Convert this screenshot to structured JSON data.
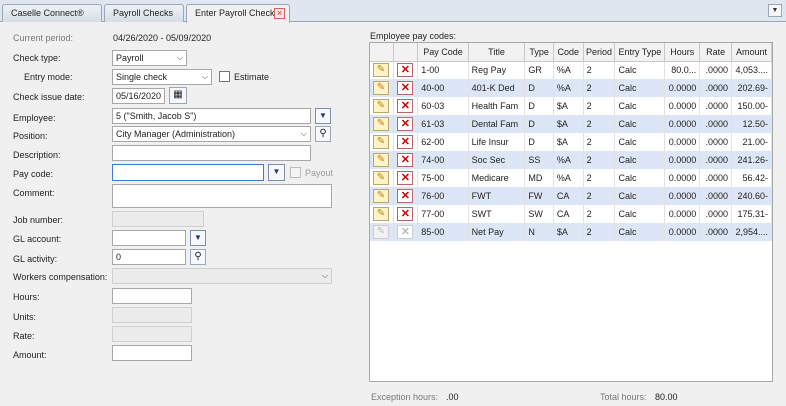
{
  "tabs": [
    {
      "label": "Caselle Connect®"
    },
    {
      "label": "Payroll Checks"
    },
    {
      "label": "Enter Payroll Checks"
    }
  ],
  "form": {
    "current_period_label": "Current period:",
    "current_period_value": "04/26/2020 - 05/09/2020",
    "check_type_label": "Check type:",
    "check_type_value": "Payroll",
    "entry_mode_label": "Entry mode:",
    "entry_mode_value": "Single check",
    "estimate_label": "Estimate",
    "check_issue_date_label": "Check issue date:",
    "check_issue_date_value": "05/16/2020",
    "employee_label": "Employee:",
    "employee_value": "5 (\"Smith, Jacob S\")",
    "position_label": "Position:",
    "position_value": "City Manager (Administration)",
    "description_label": "Description:",
    "description_value": "",
    "pay_code_label": "Pay code:",
    "pay_code_value": "",
    "payout_label": "Payout",
    "comment_label": "Comment:",
    "comment_value": "",
    "job_number_label": "Job number:",
    "gl_account_label": "GL account:",
    "gl_activity_label": "GL activity:",
    "gl_activity_value": "0",
    "workers_comp_label": "Workers compensation:",
    "hours_label": "Hours:",
    "units_label": "Units:",
    "rate_label": "Rate:",
    "amount_label": "Amount:"
  },
  "grid": {
    "title": "Employee pay codes:",
    "columns": [
      "Pay Code",
      "Title",
      "Type",
      "Code",
      "Period",
      "Entry Type",
      "Hours",
      "Rate",
      "Amount"
    ],
    "rows": [
      [
        "1-00",
        "Reg Pay",
        "GR",
        "%A",
        "2",
        "Calc",
        "80.0...",
        ".0000",
        "4,053...."
      ],
      [
        "40-00",
        "401-K Ded",
        "D",
        "%A",
        "2",
        "Calc",
        "0.0000",
        ".0000",
        "202.69-"
      ],
      [
        "60-03",
        "Health Fam",
        "D",
        "$A",
        "2",
        "Calc",
        "0.0000",
        ".0000",
        "150.00-"
      ],
      [
        "61-03",
        "Dental Fam",
        "D",
        "$A",
        "2",
        "Calc",
        "0.0000",
        ".0000",
        "12.50-"
      ],
      [
        "62-00",
        "Life Insur",
        "D",
        "$A",
        "2",
        "Calc",
        "0.0000",
        ".0000",
        "21.00-"
      ],
      [
        "74-00",
        "Soc Sec",
        "SS",
        "%A",
        "2",
        "Calc",
        "0.0000",
        ".0000",
        "241.26-"
      ],
      [
        "75-00",
        "Medicare",
        "MD",
        "%A",
        "2",
        "Calc",
        "0.0000",
        ".0000",
        "56.42-"
      ],
      [
        "76-00",
        "FWT",
        "FW",
        "CA",
        "2",
        "Calc",
        "0.0000",
        ".0000",
        "240.60-"
      ],
      [
        "77-00",
        "SWT",
        "SW",
        "CA",
        "2",
        "Calc",
        "0.0000",
        ".0000",
        "175.31-"
      ],
      [
        "85-00",
        "Net Pay",
        "N",
        "$A",
        "2",
        "Calc",
        "0.0000",
        ".0000",
        "2,954...."
      ]
    ],
    "exception_hours_label": "Exception hours:",
    "exception_hours_value": ".00",
    "total_hours_label": "Total hours:",
    "total_hours_value": "80.00"
  },
  "colors": {
    "accent": "#3a7bd5",
    "row_alt": "#dde6f6"
  }
}
